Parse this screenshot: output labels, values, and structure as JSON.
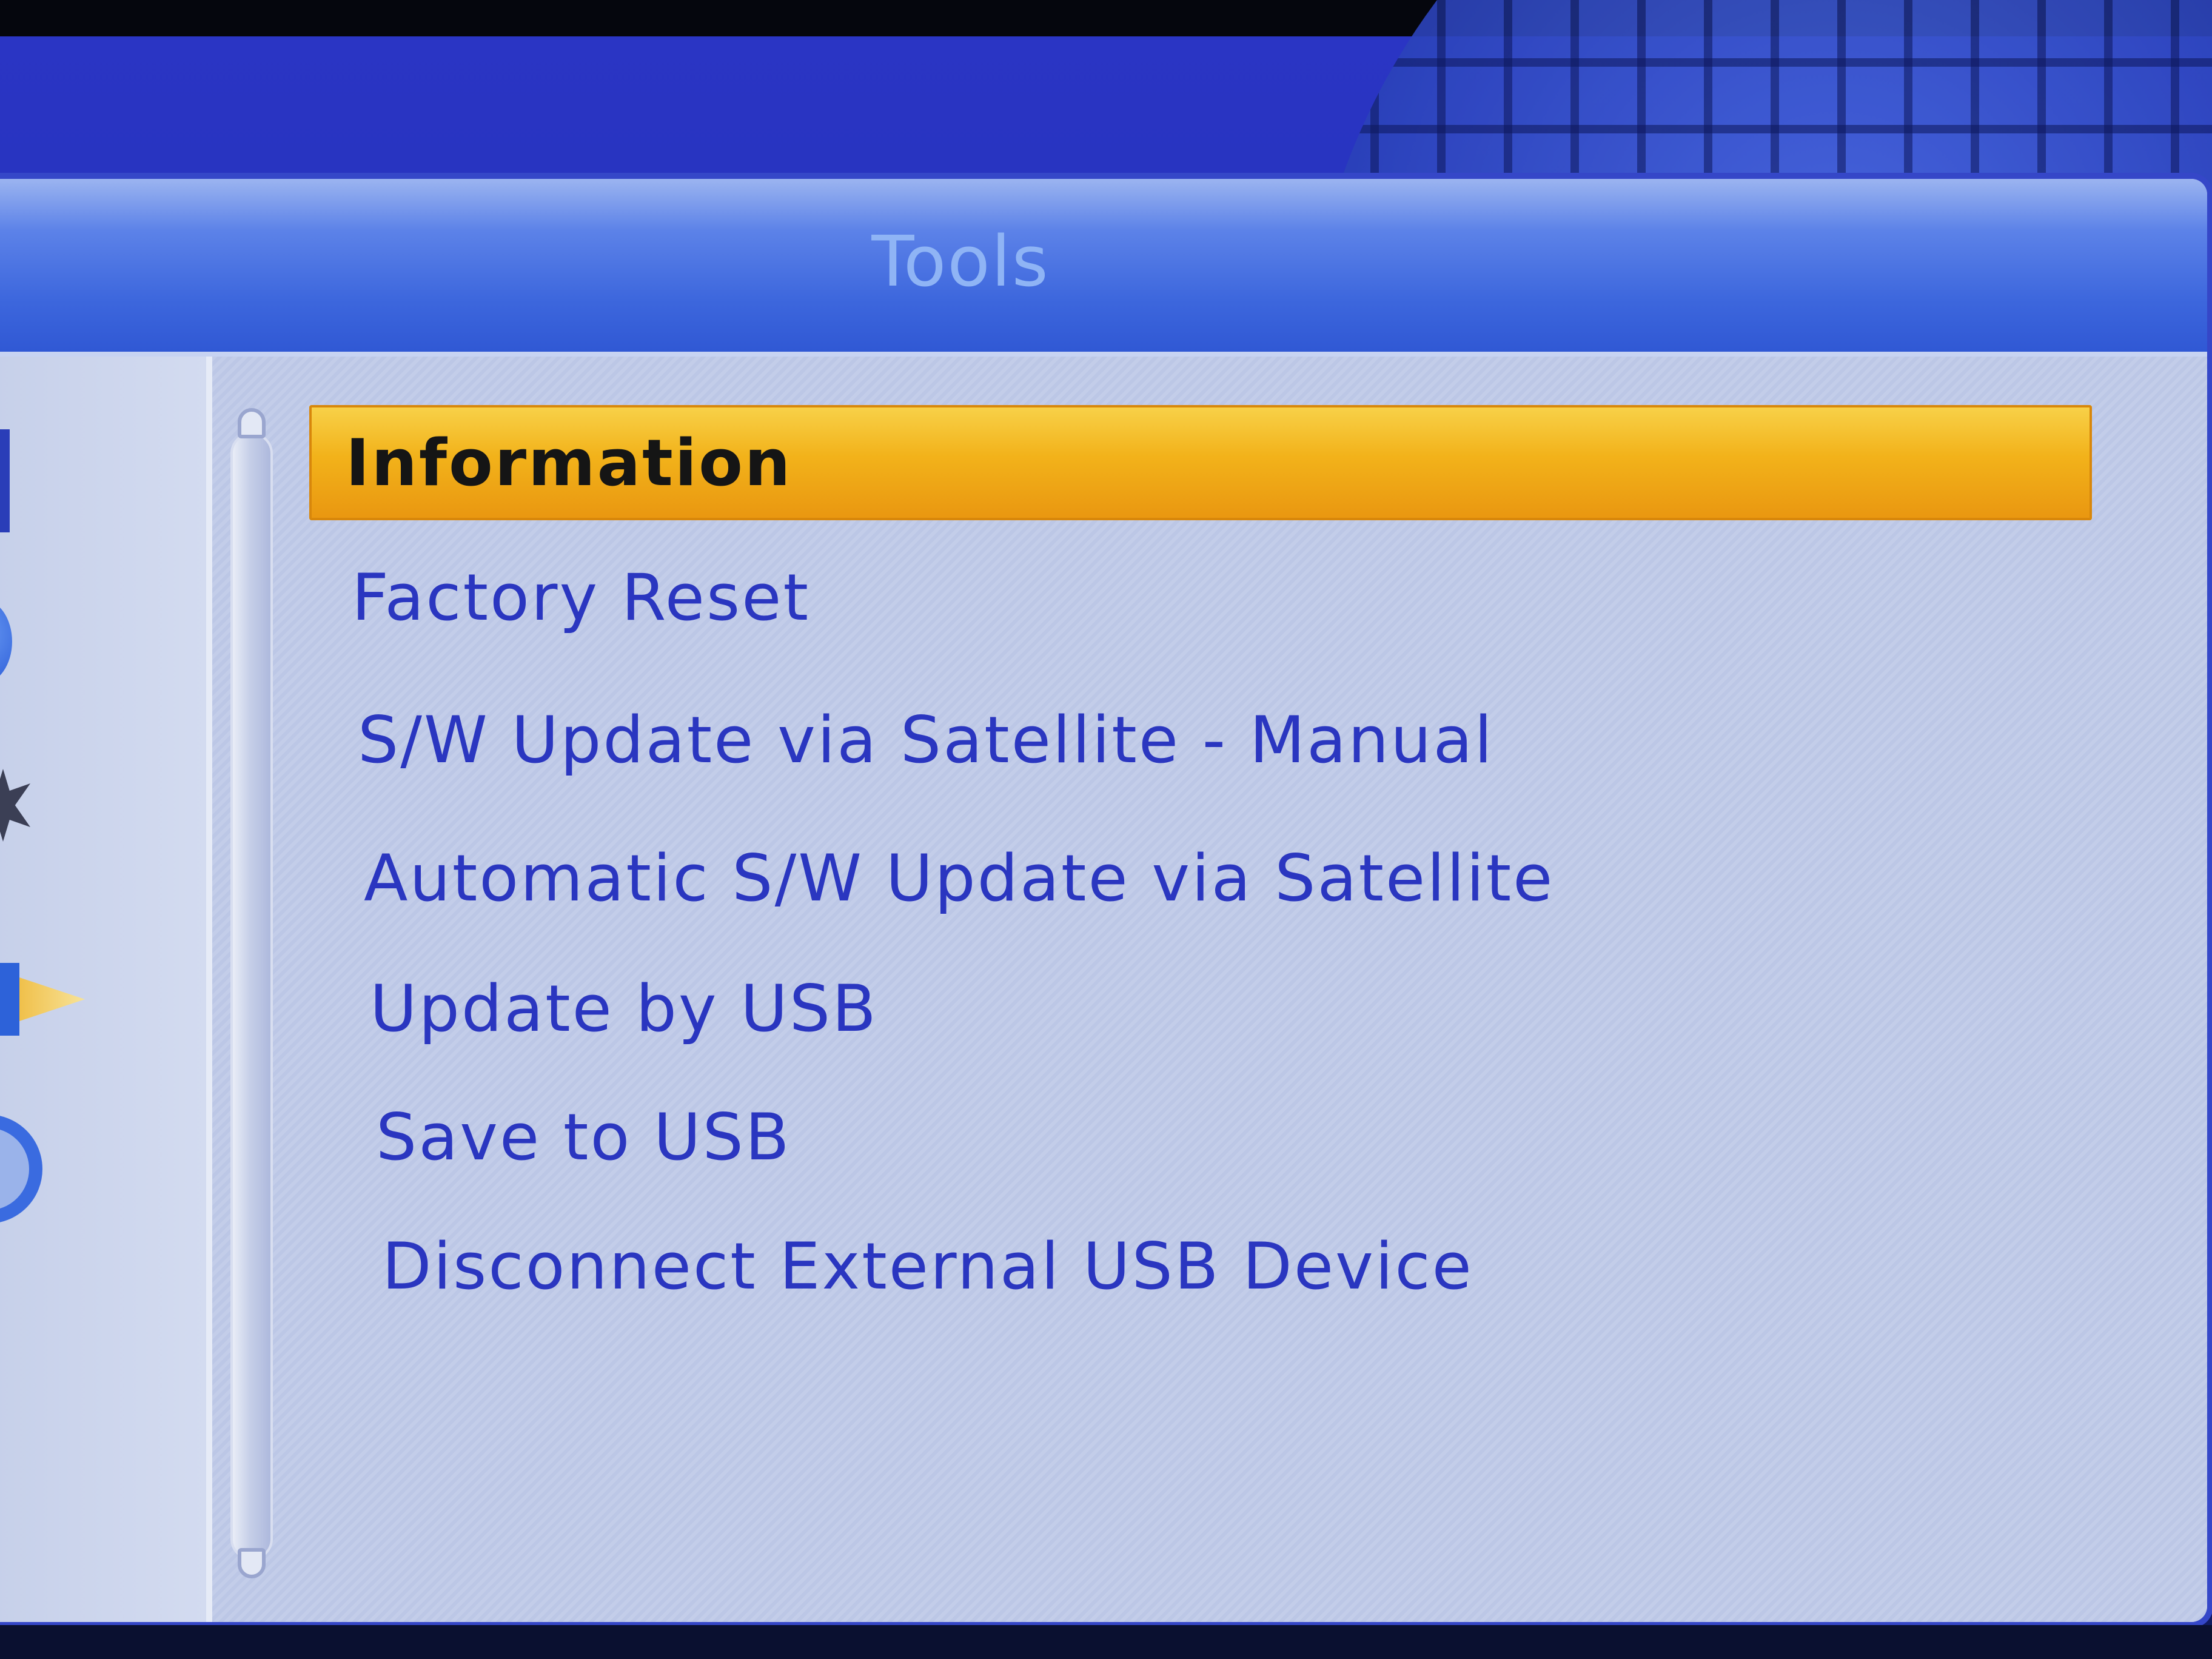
{
  "window": {
    "title": "Tools"
  },
  "menu": {
    "selected_index": 0,
    "items": [
      {
        "label": "Information"
      },
      {
        "label": "Factory Reset"
      },
      {
        "label": "S/W Update via Satellite - Manual"
      },
      {
        "label": "Automatic S/W Update via Satellite"
      },
      {
        "label": "Update by USB"
      },
      {
        "label": "Save to USB"
      },
      {
        "label": "Disconnect External USB Device"
      }
    ]
  },
  "sidebar": {
    "icons": [
      "tv-icon",
      "globe-icon",
      "star-icon",
      "folder-arrow-icon",
      "refresh-icon"
    ]
  },
  "colors": {
    "background_blue": "#2330b8",
    "title_bar": "#3d67dd",
    "panel": "#bcc7e6",
    "menu_text": "#2a36c0",
    "highlight": "#f2b21a",
    "highlight_text": "#151515"
  }
}
